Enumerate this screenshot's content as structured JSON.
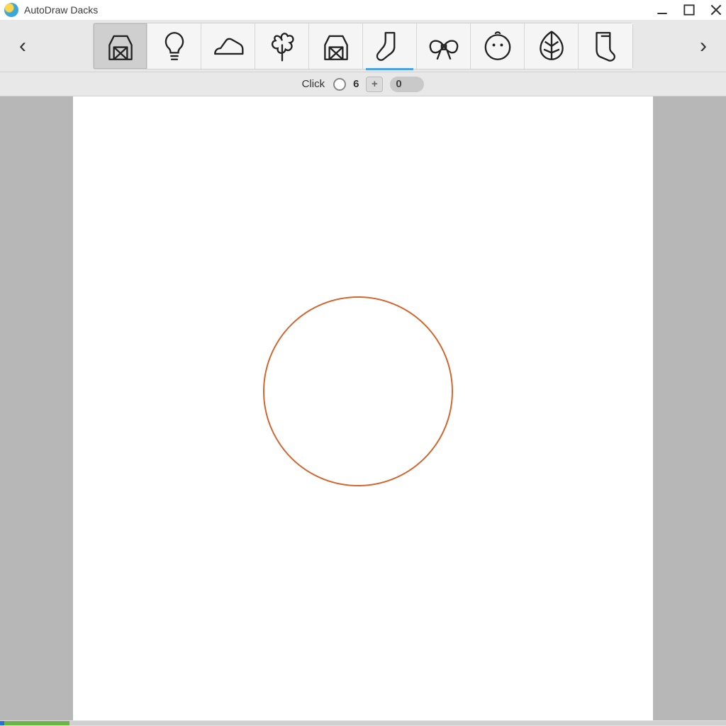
{
  "window": {
    "title": "AutoDraw Dacks"
  },
  "nav": {
    "prev": "‹",
    "next": "›"
  },
  "suggestions": [
    {
      "name": "barn",
      "selected": true,
      "highlighted": false
    },
    {
      "name": "lightbulb",
      "selected": false,
      "highlighted": false
    },
    {
      "name": "shoe",
      "selected": false,
      "highlighted": false
    },
    {
      "name": "flower",
      "selected": false,
      "highlighted": false
    },
    {
      "name": "barn-2",
      "selected": false,
      "highlighted": false
    },
    {
      "name": "sock-curve",
      "selected": false,
      "highlighted": true
    },
    {
      "name": "bow",
      "selected": false,
      "highlighted": false
    },
    {
      "name": "face",
      "selected": false,
      "highlighted": false
    },
    {
      "name": "leaf",
      "selected": false,
      "highlighted": false
    },
    {
      "name": "sock",
      "selected": false,
      "highlighted": false
    }
  ],
  "controls": {
    "label": "Click",
    "value": "6",
    "plus": "+",
    "counter": "0"
  },
  "canvas": {
    "stroke_color": "#d2662f",
    "shape": "circle"
  }
}
